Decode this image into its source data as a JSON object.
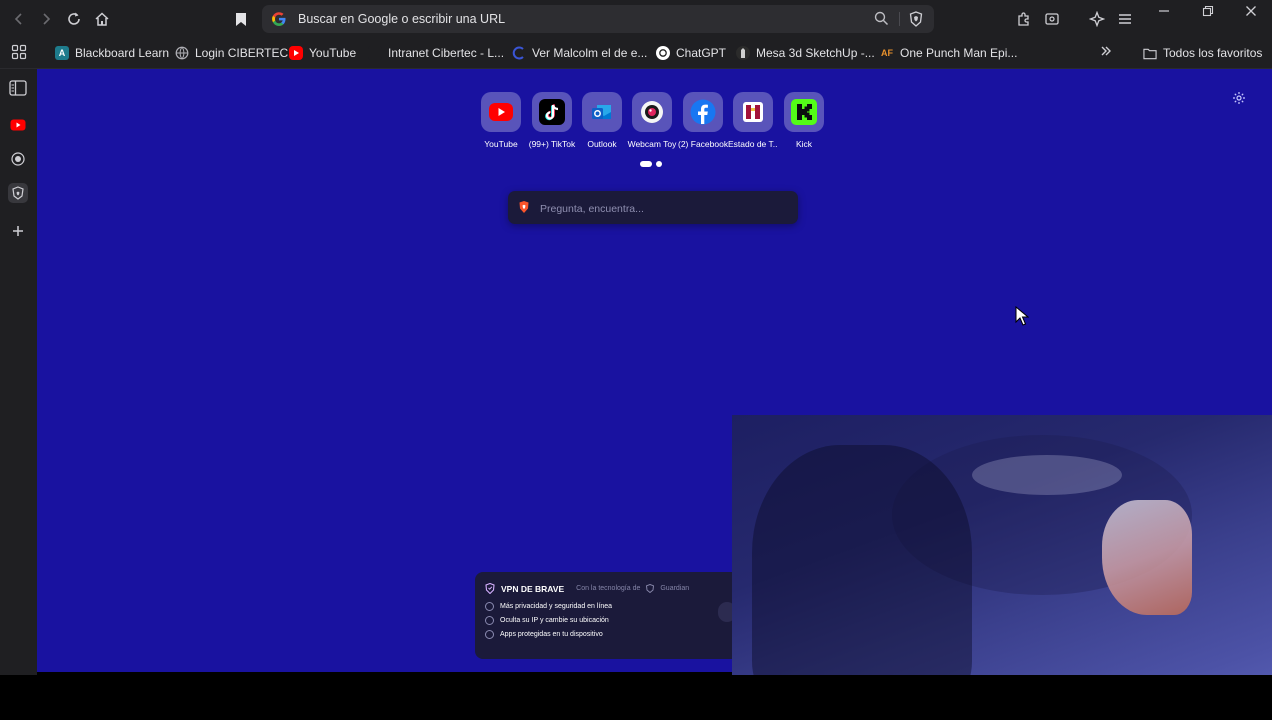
{
  "toolbar": {
    "url_placeholder": "Buscar en Google o escribir una URL"
  },
  "bookmarks": {
    "items": [
      {
        "label": "Blackboard Learn",
        "icon": "blackboard-icon",
        "color": "#1e7b8c"
      },
      {
        "label": "Login CIBERTEC",
        "icon": "globe-icon",
        "color": "#8a8a8f"
      },
      {
        "label": "YouTube",
        "icon": "youtube-icon",
        "color": "#ff0000"
      },
      {
        "label": "Intranet Cibertec - L...",
        "icon": "cibertec-icon",
        "color": "#1f1f22"
      },
      {
        "label": "Ver Malcolm el de e...",
        "icon": "streaming-icon",
        "color": "#3a55d6"
      },
      {
        "label": "ChatGPT",
        "icon": "chatgpt-icon",
        "color": "#ffffff"
      },
      {
        "label": "Mesa 3d SketchUp -...",
        "icon": "sketchup-icon",
        "color": "#2b2b2b"
      },
      {
        "label": "One Punch Man Epi...",
        "icon": "animeflv-icon",
        "color": "#e8912c"
      }
    ],
    "all_favorites": "Todos los favoritos"
  },
  "new_tab": {
    "top_sites": [
      {
        "label": "YouTube",
        "icon": "youtube-icon"
      },
      {
        "label": "(99+) TikTok",
        "icon": "tiktok-icon"
      },
      {
        "label": "Outlook",
        "icon": "outlook-icon"
      },
      {
        "label": "Webcam Toy",
        "icon": "webcam-toy-icon"
      },
      {
        "label": "(2) Facebook",
        "icon": "facebook-icon"
      },
      {
        "label": "Estado de T...",
        "icon": "estado-icon"
      },
      {
        "label": "Kick",
        "icon": "kick-icon"
      }
    ],
    "search_placeholder": "Pregunta, encuentra..."
  },
  "vpn_card": {
    "title": "VPN DE BRAVE",
    "subtitle": "Con la tecnología de",
    "provider": "Guardian",
    "features": [
      "Más privacidad y seguridad en línea",
      "Oculta su IP y cambie su ubicación",
      "Apps protegidas en tu dispositivo"
    ]
  },
  "colors": {
    "ntp_background": "#1912a0",
    "chrome": "#1f1f22",
    "accent_youtube": "#ff0000",
    "brave_orange": "#fb542b"
  }
}
